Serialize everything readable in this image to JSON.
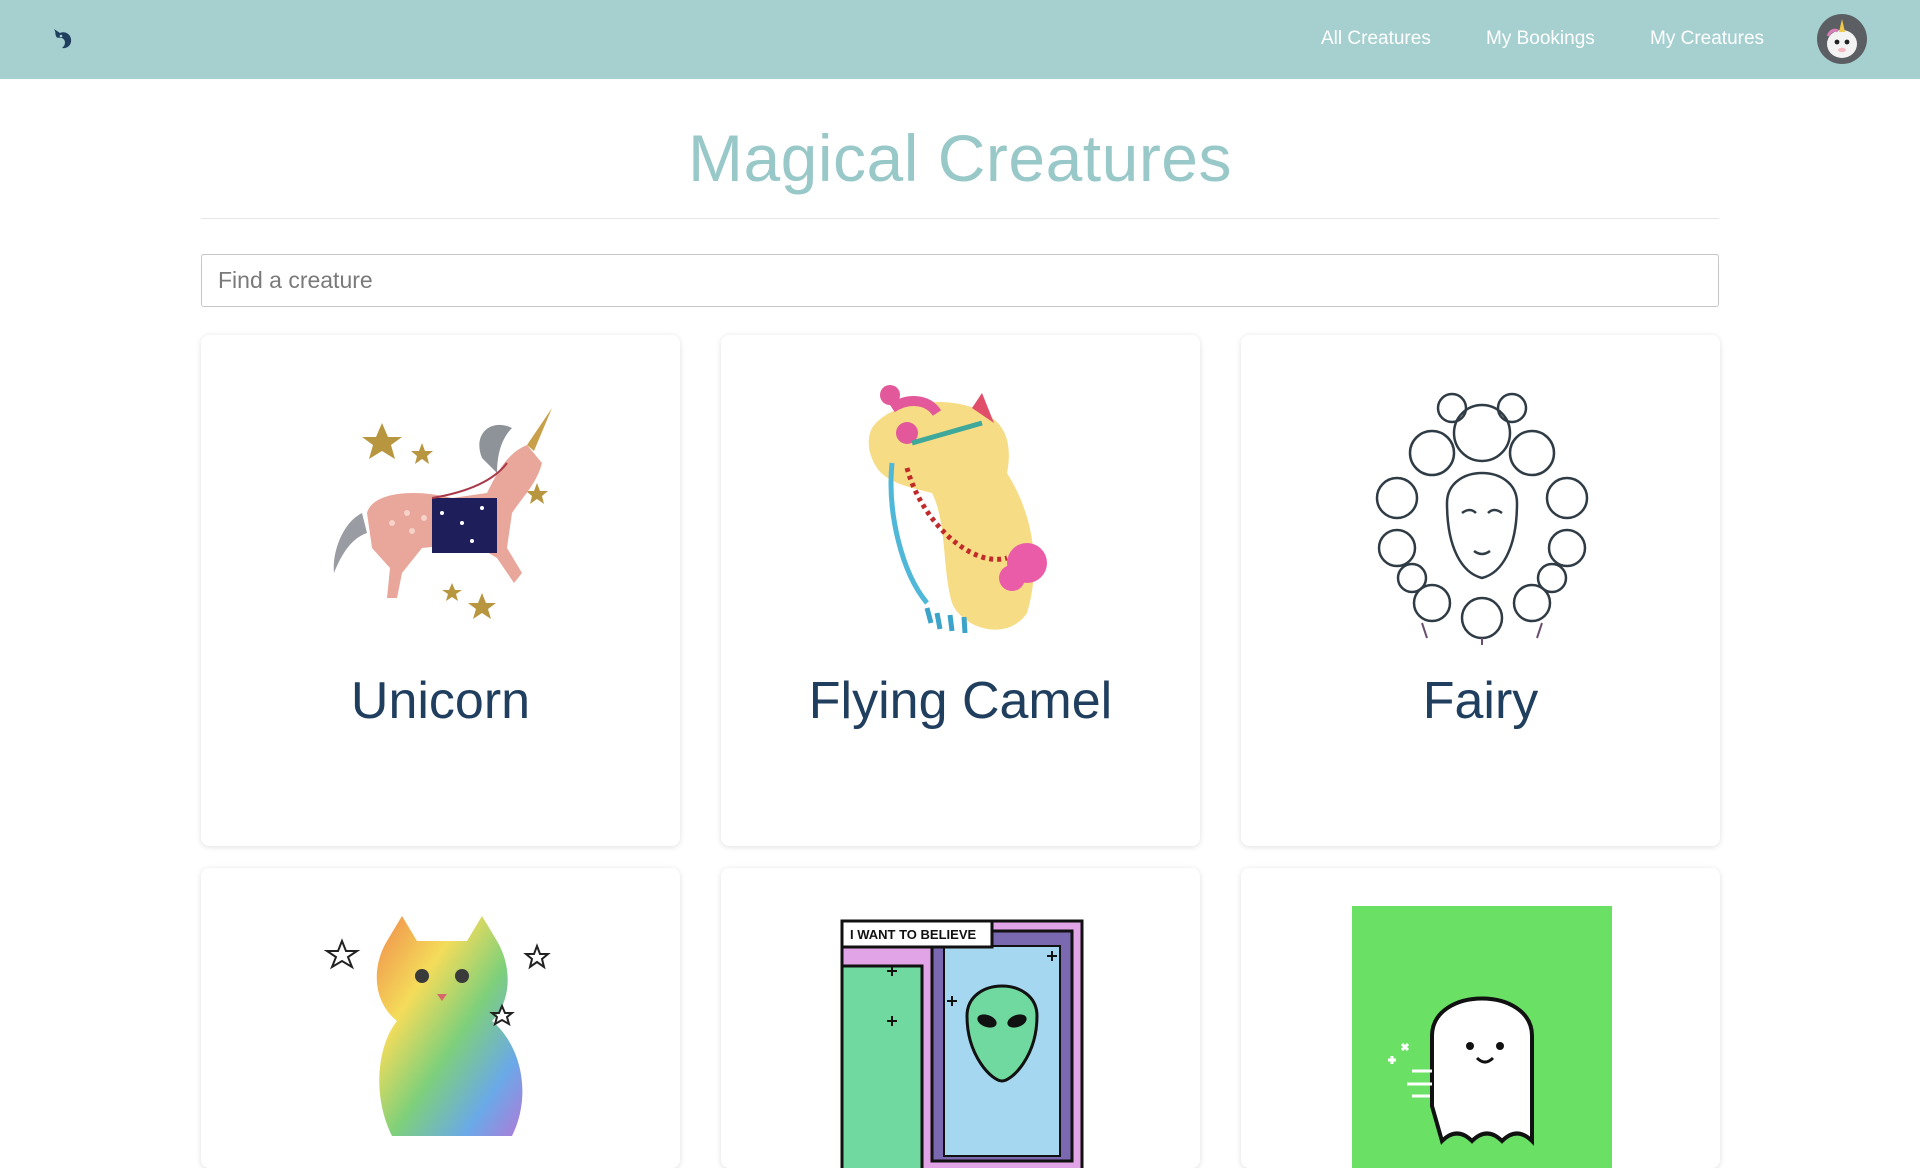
{
  "nav": {
    "logo_icon": "unicorn-icon",
    "links": [
      "All Creatures",
      "My Bookings",
      "My Creatures"
    ],
    "avatar_icon": "unicorn-avatar-icon"
  },
  "page": {
    "title": "Magical Creatures",
    "search_placeholder": "Find a creature"
  },
  "creatures": [
    {
      "name": "Unicorn",
      "image_icon": "unicorn-illustration"
    },
    {
      "name": "Flying Camel",
      "image_icon": "camel-illustration"
    },
    {
      "name": "Fairy",
      "image_icon": "fairy-illustration"
    },
    {
      "name": "",
      "image_icon": "rainbow-kitten-illustration"
    },
    {
      "name": "",
      "image_icon": "alien-illustration",
      "image_text": "I WANT TO BELIEVE"
    },
    {
      "name": "",
      "image_icon": "ghost-illustration"
    }
  ],
  "colors": {
    "navbar": "#a6cfd0",
    "title": "#99c8c9",
    "card_name": "#203e5e"
  }
}
